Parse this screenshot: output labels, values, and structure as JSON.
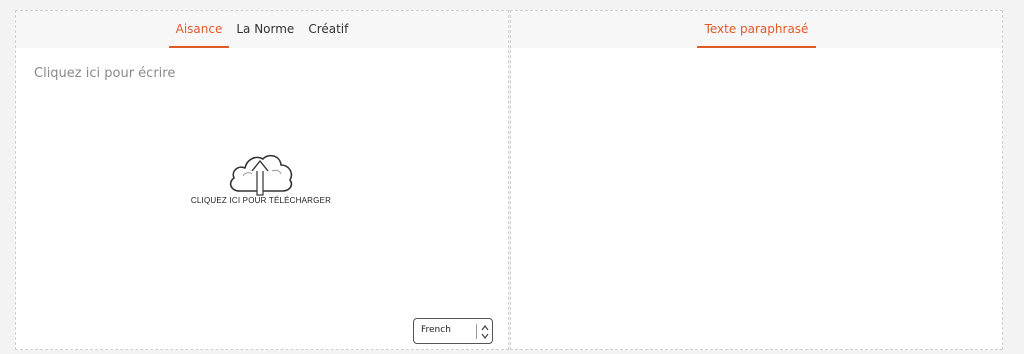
{
  "input_panel": {
    "tabs": [
      {
        "label": "Aisance",
        "active": true
      },
      {
        "label": "La Norme",
        "active": false
      },
      {
        "label": "Créatif",
        "active": false
      }
    ],
    "placeholder": "Cliquez ici pour écrire",
    "upload_label": "CLIQUEZ ICI POUR TÉLÉCHARGER",
    "language": "French"
  },
  "output_panel": {
    "tab_label": "Texte paraphrasé"
  },
  "colors": {
    "accent": "#e05a28",
    "tabbar_bg": "#f7f7f7",
    "page_bg": "#f3f3f3"
  }
}
